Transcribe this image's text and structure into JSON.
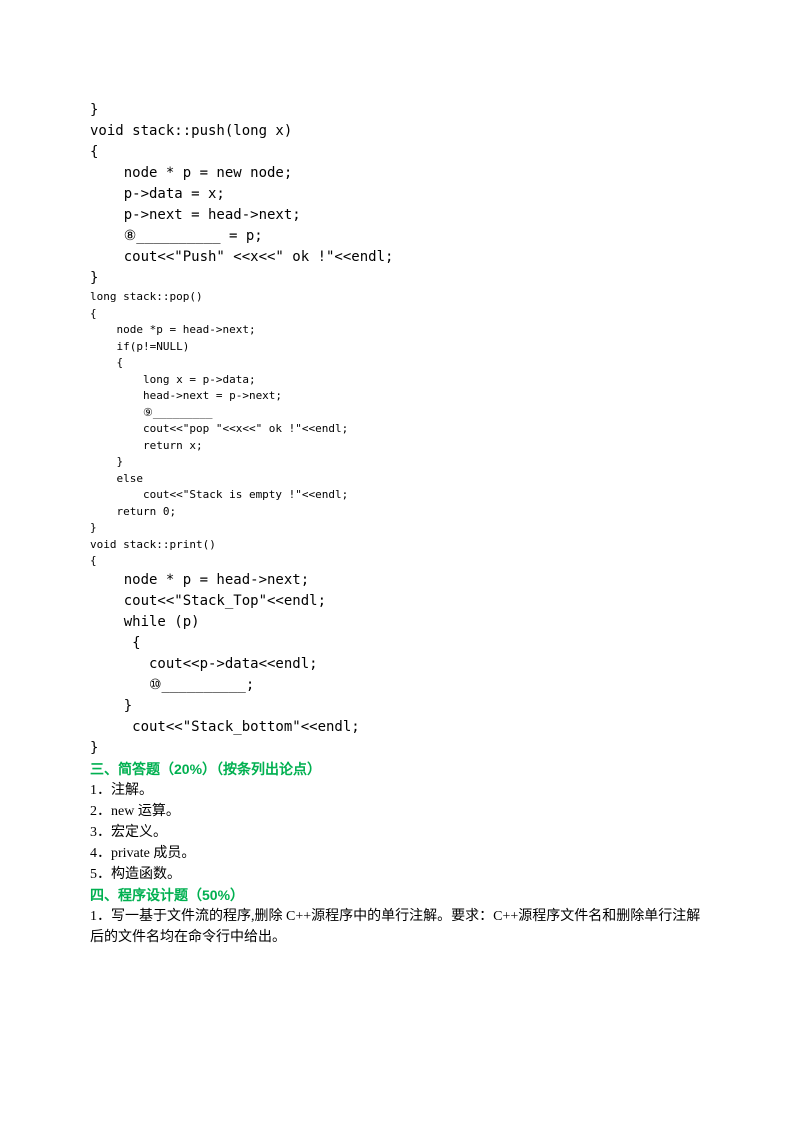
{
  "code": {
    "l1": "}",
    "l2": "void stack::push(long x)",
    "l3": "{",
    "l4": "    node * p = new node;",
    "l5": "    p->data = x;",
    "l6": "    p->next = head->next;",
    "l7": "    ⑧__________ = p;",
    "l8": "    cout<<\"Push\" <<x<<\" ok !\"<<endl;",
    "l9": "}",
    "l10": "long stack::pop()",
    "l11": "{",
    "l12": "    node *p = head->next;",
    "l13": "    if(p!=NULL)",
    "l14": "    {",
    "l15": "        long x = p->data;",
    "l16": "        head->next = p->next;",
    "l17": "        ⑨_________",
    "l18": "        cout<<\"pop \"<<x<<\" ok !\"<<endl;",
    "l19": "        return x;",
    "l20": "    }",
    "l21": "    else",
    "l22": "        cout<<\"Stack is empty !\"<<endl;",
    "l23": "    return 0;",
    "l24": "}",
    "l25": "void stack::print()",
    "l26": "{",
    "l27": "    node * p = head->next;",
    "l28": "    cout<<\"Stack_Top\"<<endl;",
    "l29": "    while (p)",
    "l30": "     {",
    "l31": "       cout<<p->data<<endl;",
    "l32": "       ⑩__________;",
    "l33": "    }",
    "l34": "     cout<<\"Stack_bottom\"<<endl;",
    "l35": "}"
  },
  "section3": {
    "header": "三、简答题（20%）（按条列出论点）",
    "q1": "1．注解。",
    "q2": "2．new 运算。",
    "q3": "3．宏定义。",
    "q4": "4．private 成员。",
    "q5": "   5．构造函数。"
  },
  "section4": {
    "header": "四、程序设计题（50%）",
    "q1": "1．写一基于文件流的程序,删除 C++源程序中的单行注解。要求：C++源程序文件名和删除单行注解后的文件名均在命令行中给出。"
  }
}
